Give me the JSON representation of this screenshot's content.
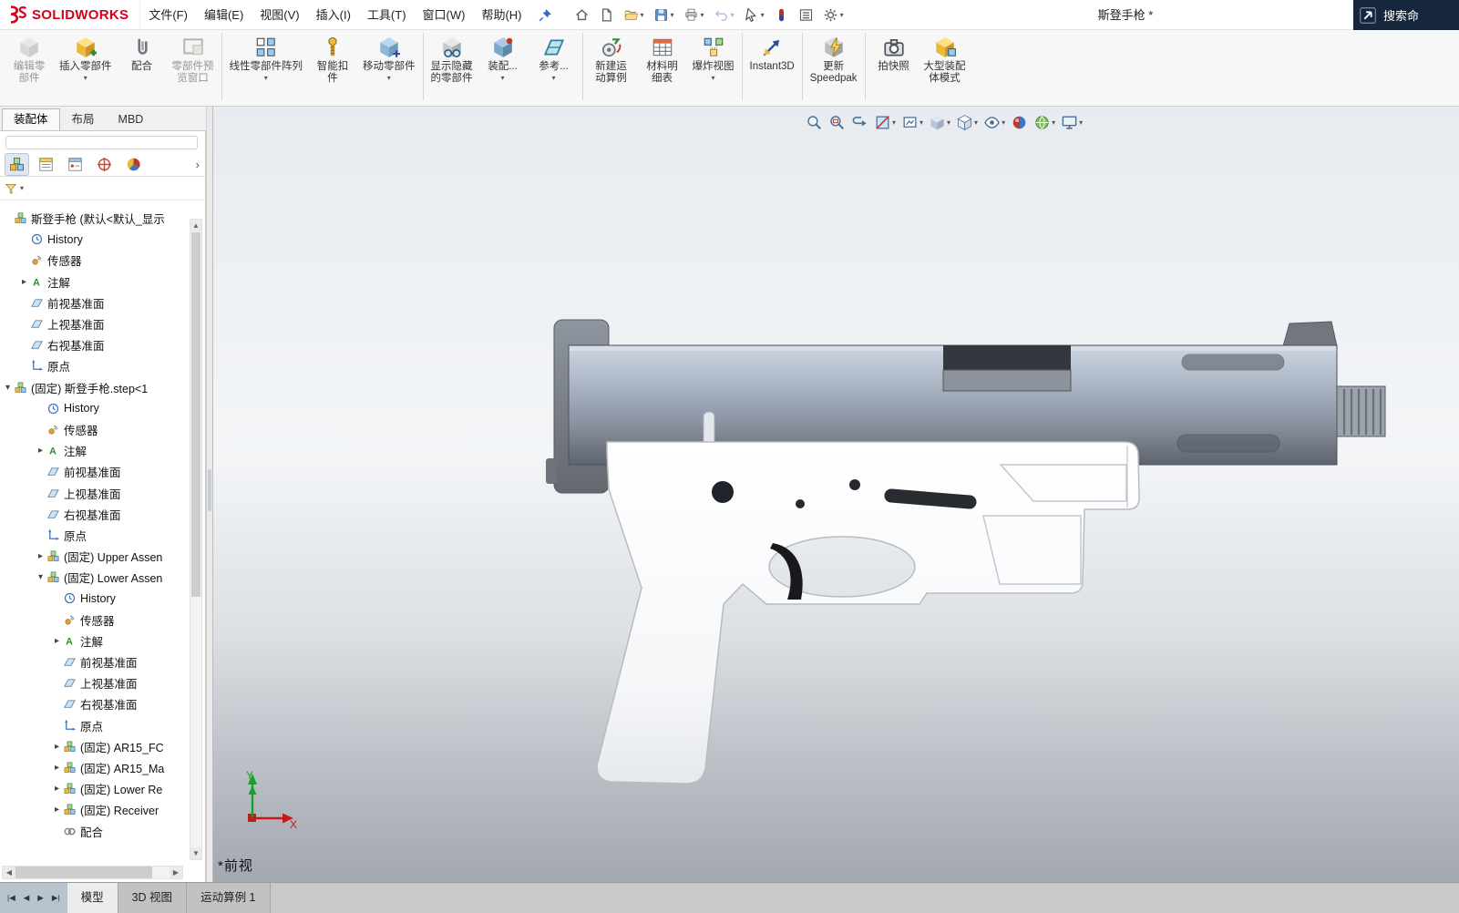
{
  "window": {
    "logo_text": "SOLIDWORKS",
    "title": "斯登手枪 *",
    "search_text": "搜索命"
  },
  "menubar": {
    "items": [
      {
        "id": "file",
        "label": "文件(F)"
      },
      {
        "id": "edit",
        "label": "编辑(E)"
      },
      {
        "id": "view",
        "label": "视图(V)"
      },
      {
        "id": "insert",
        "label": "插入(I)"
      },
      {
        "id": "tools",
        "label": "工具(T)"
      },
      {
        "id": "window",
        "label": "窗口(W)"
      },
      {
        "id": "help",
        "label": "帮助(H)"
      }
    ]
  },
  "quickbar": [
    {
      "id": "home"
    },
    {
      "id": "new-doc"
    },
    {
      "id": "open",
      "caret": true
    },
    {
      "id": "save",
      "caret": true
    },
    {
      "id": "print",
      "caret": true
    },
    {
      "id": "undo",
      "caret": true,
      "disabled": true
    },
    {
      "id": "select",
      "caret": true
    },
    {
      "id": "rebuild"
    },
    {
      "id": "taskpane"
    },
    {
      "id": "options",
      "caret": true
    }
  ],
  "ribbon": {
    "groups": [
      [
        {
          "id": "edit-component",
          "lines": [
            "编辑零",
            "部件"
          ],
          "icon": "edit-component-icon",
          "disabled": true
        },
        {
          "id": "insert-component",
          "lines": [
            "插入零部件"
          ],
          "icon": "insert-component-icon",
          "caret": true
        },
        {
          "id": "mate",
          "lines": [
            "配合"
          ],
          "icon": "mate-icon"
        },
        {
          "id": "component-preview-window",
          "lines": [
            "零部件预",
            "览窗口"
          ],
          "icon": "preview-window-icon",
          "disabled": true
        }
      ],
      [
        {
          "id": "linear-component-pattern",
          "lines": [
            "线性零部件阵列"
          ],
          "icon": "linear-pattern-icon",
          "caret": true
        },
        {
          "id": "smart-fasteners",
          "lines": [
            "智能扣",
            "件"
          ],
          "icon": "smart-fastener-icon"
        },
        {
          "id": "move-component",
          "lines": [
            "移动零部件"
          ],
          "icon": "move-component-icon",
          "caret": true
        }
      ],
      [
        {
          "id": "show-hidden-components",
          "lines": [
            "显示隐藏",
            "的零部件"
          ],
          "icon": "show-hidden-icon"
        },
        {
          "id": "assembly-features",
          "lines": [
            "装配..."
          ],
          "icon": "assembly-features-icon",
          "caret": true
        },
        {
          "id": "reference-geometry",
          "lines": [
            "参考..."
          ],
          "icon": "reference-geometry-icon",
          "caret": true
        }
      ],
      [
        {
          "id": "new-motion-study",
          "lines": [
            "新建运",
            "动算例"
          ],
          "icon": "motion-study-icon"
        },
        {
          "id": "bill-of-materials",
          "lines": [
            "材料明",
            "细表"
          ],
          "icon": "bom-icon"
        },
        {
          "id": "exploded-view",
          "lines": [
            "爆炸视图"
          ],
          "icon": "exploded-view-icon",
          "caret": true
        }
      ],
      [
        {
          "id": "instant3d",
          "lines": [
            "Instant3D"
          ],
          "icon": "instant3d-icon"
        }
      ],
      [
        {
          "id": "update-speedpak",
          "lines": [
            "更新",
            "Speedpak"
          ],
          "icon": "speedpak-icon"
        }
      ],
      [
        {
          "id": "take-snapshot",
          "lines": [
            "拍快照"
          ],
          "icon": "snapshot-icon"
        },
        {
          "id": "large-assembly-mode",
          "lines": [
            "大型装配",
            "体模式"
          ],
          "icon": "large-assembly-icon"
        }
      ]
    ]
  },
  "command_tabs": [
    {
      "id": "assembly",
      "label": "装配体",
      "active": true
    },
    {
      "id": "layout",
      "label": "布局"
    },
    {
      "id": "mbd",
      "label": "MBD"
    }
  ],
  "manager_tabs": [
    {
      "id": "featuremanager",
      "icon": "featuremanager-icon",
      "active": true
    },
    {
      "id": "propertymanager",
      "icon": "propertymanager-icon"
    },
    {
      "id": "configurationmanager",
      "icon": "configmanager-icon"
    },
    {
      "id": "dimxpertmanager",
      "icon": "dimxpert-icon"
    },
    {
      "id": "displaymanager",
      "icon": "displaymanager-icon"
    }
  ],
  "tree": {
    "items": [
      {
        "level": 0,
        "icon": "assembly-icon",
        "label": "斯登手枪 (默认<默认_显示"
      },
      {
        "level": 1,
        "icon": "history-icon",
        "label": "History"
      },
      {
        "level": 1,
        "icon": "sensor-icon",
        "label": "传感器"
      },
      {
        "level": 1,
        "arrow": "right",
        "icon": "annotation-icon",
        "label": "注解"
      },
      {
        "level": 1,
        "icon": "plane-icon",
        "label": "前视基准面"
      },
      {
        "level": 1,
        "icon": "plane-icon",
        "label": "上视基准面"
      },
      {
        "level": 1,
        "icon": "plane-icon",
        "label": "右视基准面"
      },
      {
        "level": 1,
        "icon": "origin-icon",
        "label": "原点"
      },
      {
        "level": 0,
        "arrow": "down",
        "icon": "assembly-icon",
        "label": "(固定) 斯登手枪.step<1"
      },
      {
        "level": 2,
        "icon": "history-icon",
        "label": "History"
      },
      {
        "level": 2,
        "icon": "sensor-icon",
        "label": "传感器"
      },
      {
        "level": 2,
        "arrow": "right",
        "icon": "annotation-icon",
        "label": "注解"
      },
      {
        "level": 2,
        "icon": "plane-icon",
        "label": "前视基准面"
      },
      {
        "level": 2,
        "icon": "plane-icon",
        "label": "上视基准面"
      },
      {
        "level": 2,
        "icon": "plane-icon",
        "label": "右视基准面"
      },
      {
        "level": 2,
        "icon": "origin-icon",
        "label": "原点"
      },
      {
        "level": 2,
        "arrow": "right",
        "icon": "assembly-icon",
        "label": "(固定) Upper Assen"
      },
      {
        "level": 2,
        "arrow": "down",
        "icon": "assembly-icon",
        "label": "(固定) Lower Assen"
      },
      {
        "level": 3,
        "icon": "history-icon",
        "label": "History"
      },
      {
        "level": 3,
        "icon": "sensor-icon",
        "label": "传感器"
      },
      {
        "level": 3,
        "arrow": "right",
        "icon": "annotation-icon",
        "label": "注解"
      },
      {
        "level": 3,
        "icon": "plane-icon",
        "label": "前视基准面"
      },
      {
        "level": 3,
        "icon": "plane-icon",
        "label": "上视基准面"
      },
      {
        "level": 3,
        "icon": "plane-icon",
        "label": "右视基准面"
      },
      {
        "level": 3,
        "icon": "origin-icon",
        "label": "原点"
      },
      {
        "level": 3,
        "arrow": "right",
        "icon": "assembly-icon",
        "label": "(固定) AR15_FC"
      },
      {
        "level": 3,
        "arrow": "right",
        "icon": "assembly-icon",
        "label": "(固定) AR15_Ma"
      },
      {
        "level": 3,
        "arrow": "right",
        "icon": "assembly-icon",
        "label": "(固定) Lower Re"
      },
      {
        "level": 3,
        "arrow": "right",
        "icon": "assembly-icon",
        "label": "(固定) Receiver"
      },
      {
        "level": 3,
        "icon": "mates-icon",
        "label": "配合"
      }
    ]
  },
  "viewport": {
    "view_label": "*前视",
    "triad": {
      "x": "X",
      "y": "Y"
    },
    "headsup": [
      {
        "id": "zoom-fit"
      },
      {
        "id": "zoom-area"
      },
      {
        "id": "previous-view"
      },
      {
        "id": "section-view",
        "caret": true
      },
      {
        "id": "drawing-view",
        "caret": true
      },
      {
        "id": "view-orientation",
        "caret": true
      },
      {
        "id": "display-style",
        "caret": true
      },
      {
        "id": "hide-show",
        "caret": true
      },
      {
        "id": "appearance"
      },
      {
        "id": "scene",
        "caret": true
      },
      {
        "id": "view-settings",
        "caret": true
      }
    ]
  },
  "bottom_nav": [
    {
      "id": "first",
      "glyph": "|◀"
    },
    {
      "id": "prev",
      "glyph": "◀"
    },
    {
      "id": "next",
      "glyph": "▶"
    },
    {
      "id": "last",
      "glyph": "▶|"
    }
  ],
  "bottom_tabs": [
    {
      "id": "model",
      "label": "模型",
      "active": true
    },
    {
      "id": "3d-views",
      "label": "3D 视图"
    },
    {
      "id": "motion-study-1",
      "label": "运动算例 1"
    }
  ],
  "colors": {
    "brand_red": "#d6001c",
    "triad_x": "#c41a1a",
    "triad_y": "#18a02c",
    "viewport_top": "#e7ebf0",
    "viewport_bottom": "#a3a8b0"
  }
}
